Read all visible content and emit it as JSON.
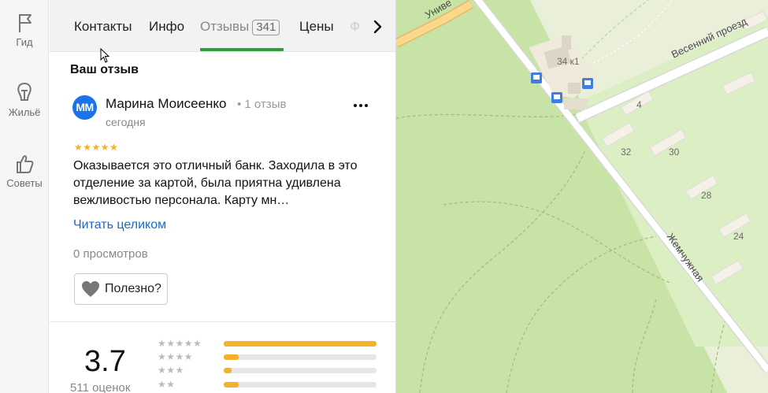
{
  "rail": {
    "items": [
      {
        "label": "Гид",
        "icon": "flag-icon"
      },
      {
        "label": "Жильё",
        "icon": "house-icon"
      },
      {
        "label": "Советы",
        "icon": "thumbs-up-icon"
      }
    ]
  },
  "tabs": {
    "items": [
      {
        "label": "Контакты"
      },
      {
        "label": "Инфо"
      },
      {
        "label": "Отзывы",
        "count": "341",
        "active": true
      },
      {
        "label": "Цены"
      },
      {
        "label": "Ф"
      }
    ],
    "next_icon": "chevron-right-icon"
  },
  "review_section": {
    "title": "Ваш отзыв"
  },
  "review": {
    "avatar_initials": "MM",
    "author": "Марина Моисеенко",
    "author_reviews": "• 1 отзыв",
    "date": "сегодня",
    "rating": 5,
    "stars": "★★★★★",
    "text": "Оказывается это отличный банк. Заходила в это отделение за картой, была приятна удивлена вежливостью персонала. Карту мн…",
    "read_more": "Читать целиком",
    "views": "0 просмотров",
    "useful_label": "Полезно?",
    "more_icon": "more-dots-icon"
  },
  "summary": {
    "rating": "3.7",
    "ratings_count": "511 оценок",
    "bars": [
      {
        "stars": "★★★★★",
        "fraction": 1.0
      },
      {
        "stars": "★★★★",
        "fraction": 0.1
      },
      {
        "stars": "★★★",
        "fraction": 0.05
      },
      {
        "stars": "★★",
        "fraction": 0.1
      }
    ]
  },
  "map": {
    "streets": [
      "Весенний проезд",
      "Жемчужная",
      "Униве"
    ],
    "building_labels": [
      "34 к1",
      "4",
      "32",
      "30",
      "28",
      "24"
    ],
    "colors": {
      "forest": "#c7e3a5",
      "urban": "#f3efe3",
      "road": "#ffffff",
      "park": "#dcefc4",
      "transit": "#3f7de0"
    }
  }
}
